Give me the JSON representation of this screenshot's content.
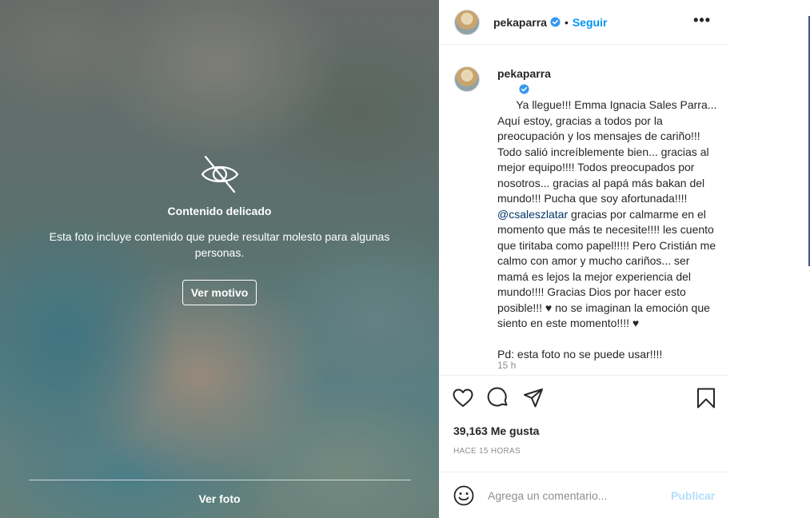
{
  "media": {
    "sensitive_title": "Contenido delicado",
    "sensitive_description": "Esta foto incluye contenido que puede resultar molesto para algunas personas.",
    "see_reason_label": "Ver motivo",
    "see_photo_label": "Ver foto",
    "icon": "eye-slash-icon"
  },
  "header": {
    "username": "pekaparra",
    "verified_icon": "verified-badge-icon",
    "separator": "•",
    "follow_label": "Seguir",
    "more_label": "•••"
  },
  "caption": {
    "username": "pekaparra",
    "text_before_mention": "Ya llegue!!! Emma Ignacia Sales Parra... Aquí estoy, gracias a todos por la preocupación y los mensajes de cariño!!! Todo salió increíblemente bien... gracias al mejor equipo!!!! Todos preocupados por nosotros... gracias al papá más bakan del mundo!!! Pucha que soy afortunada!!!! ",
    "mention": "@csaleszlatar",
    "text_after_mention": " gracias por calmarme en el momento que más te necesite!!!! les cuento que tiritaba como papel!!!!! Pero Cristián me calmo con amor y mucho cariños... ser mamá es lejos la mejor experiencia del mundo!!!! Gracias Dios por hacer esto posible!!! ♥ no se imaginan la emoción que siento en este momento!!!! ♥\n\nPd: esta foto no se puede usar!!!!",
    "time_ago": "15 h"
  },
  "actions": {
    "like_icon": "heart-icon",
    "comment_icon": "comment-icon",
    "share_icon": "paper-plane-icon",
    "save_icon": "bookmark-icon"
  },
  "likes_label": "39,163 Me gusta",
  "posted_label": "HACE 15 HORAS",
  "comment": {
    "placeholder": "Agrega un comentario...",
    "publish_label": "Publicar",
    "emoji_icon": "emoji-icon"
  },
  "colors": {
    "link_blue": "#0095f6",
    "publish_disabled": "#b2dffc",
    "mention": "#00376b",
    "muted": "#8e8e8e"
  }
}
